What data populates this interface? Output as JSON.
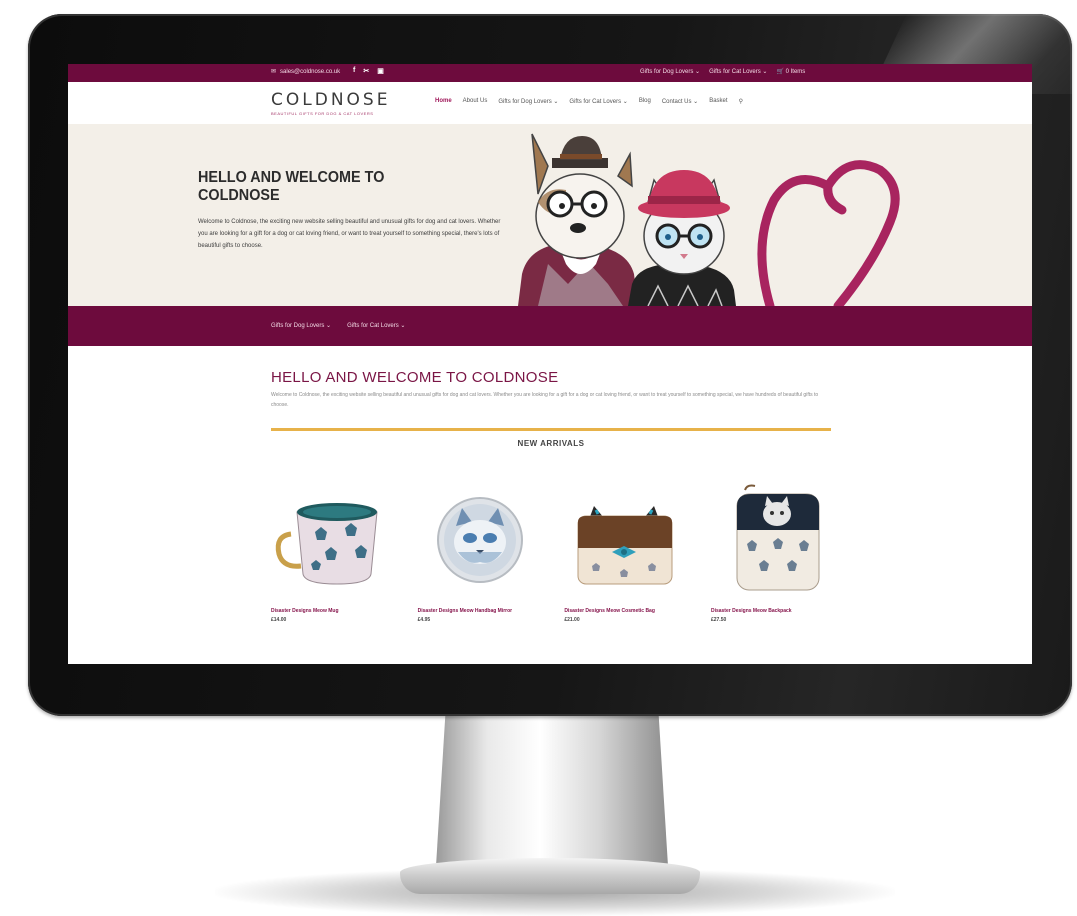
{
  "topbar": {
    "email": "sales@coldnose.co.uk",
    "social_icons": [
      "facebook-icon",
      "twitter-icon",
      "instagram-icon"
    ],
    "social_glyphs": [
      "f",
      "✂",
      "▣"
    ],
    "links": [
      "Gifts for Dog Lovers",
      "Gifts for Cat Lovers"
    ],
    "basket_label": "0 Items"
  },
  "header": {
    "logo_text": "COLDNOSE",
    "logo_tagline": "BEAUTIFUL GIFTS FOR DOG & CAT LOVERS",
    "nav": [
      "Home",
      "About Us",
      "Gifts for Dog Lovers",
      "Gifts for Cat Lovers",
      "Blog",
      "Contact Us",
      "Basket"
    ],
    "active_nav": "Home"
  },
  "hero": {
    "title": "HELLO AND WELCOME TO COLDNOSE",
    "text": "Welcome to Coldnose, the exciting new website selling beautiful and unusual gifts for dog and cat lovers. Whether you are looking for a gift for a dog or cat loving friend, or want to treat yourself to something special, there's lots of beautiful gifts to choose."
  },
  "subnav": {
    "links": [
      "Gifts for Dog Lovers",
      "Gifts for Cat Lovers"
    ]
  },
  "welcome": {
    "title": "HELLO AND WELCOME TO COLDNOSE",
    "text": "Welcome to Coldnose, the exciting website selling beautiful and unusual gifts for dog and cat lovers. Whether you are looking for a gift for a dog or cat loving friend, or want to treat yourself to something special, we have hundreds of beautiful gifts to choose."
  },
  "section_title": "NEW ARRIVALS",
  "products": [
    {
      "name": "Disaster Designs Meow Mug",
      "price": "£14.00"
    },
    {
      "name": "Disaster Designs Meow Handbag Mirror",
      "price": "£4.95"
    },
    {
      "name": "Disaster Designs Meow Cosmetic Bag",
      "price": "£21.00"
    },
    {
      "name": "Disaster Designs Meow Backpack",
      "price": "£27.50"
    }
  ],
  "colors": {
    "brand_plum": "#6d0b3d",
    "accent_pink": "#a1195b",
    "divider_gold": "#e7b24a",
    "hero_bg": "#f3efe8"
  }
}
